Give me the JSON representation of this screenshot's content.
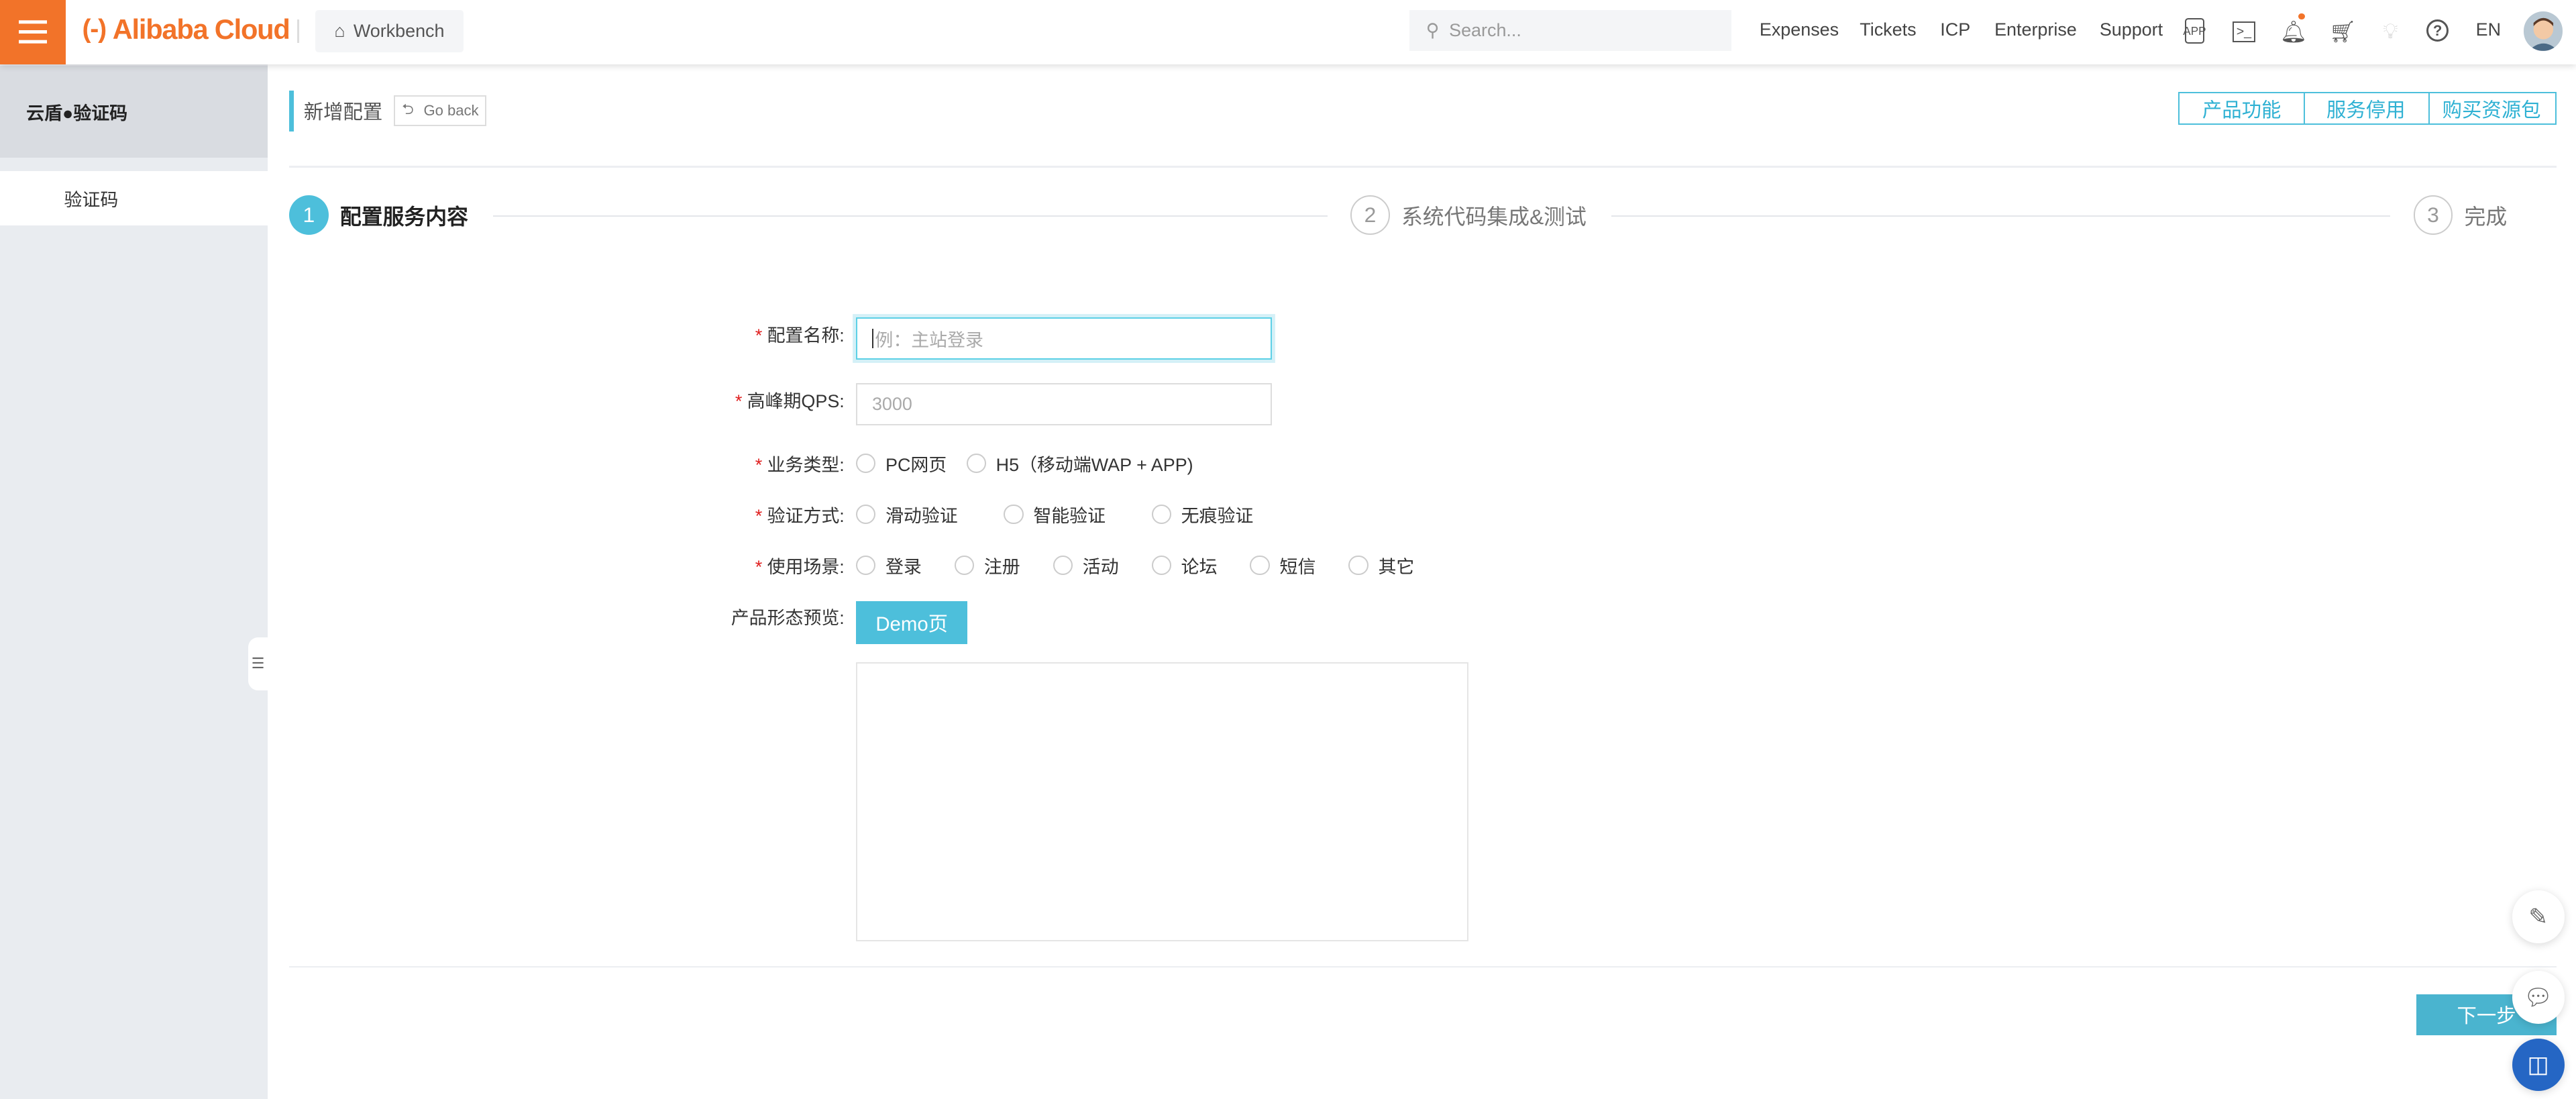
{
  "header": {
    "logo": "Alibaba Cloud",
    "workbench": "Workbench",
    "search_placeholder": "Search...",
    "nav": [
      "Expenses",
      "Tickets",
      "ICP",
      "Enterprise",
      "Support"
    ],
    "icons": [
      "app-icon",
      "terminal-icon",
      "bell-icon",
      "cart-icon",
      "lightbulb-icon",
      "help-icon"
    ],
    "lang": "EN",
    "accent": "#f27329"
  },
  "sidebar": {
    "title": "云盾●验证码",
    "items": [
      {
        "label": "验证码"
      }
    ]
  },
  "page": {
    "title": "新增配置",
    "go_back": "Go back",
    "top_buttons": [
      "产品功能",
      "服务停用",
      "购买资源包"
    ],
    "accent": "#4dbfdb"
  },
  "steps": [
    {
      "num": "1",
      "label": "配置服务内容",
      "active": true
    },
    {
      "num": "2",
      "label": "系统代码集成&测试",
      "active": false
    },
    {
      "num": "3",
      "label": "完成",
      "active": false
    }
  ],
  "form": {
    "name": {
      "label": "配置名称:",
      "placeholder": "例：主站登录",
      "value": ""
    },
    "qps": {
      "label": "高峰期QPS:",
      "placeholder": "3000",
      "value": ""
    },
    "biz": {
      "label": "业务类型:",
      "options": [
        "PC网页",
        "H5（移动端WAP + APP)"
      ]
    },
    "method": {
      "label": "验证方式:",
      "options": [
        "滑动验证",
        "智能验证",
        "无痕验证"
      ]
    },
    "scene": {
      "label": "使用场景:",
      "options": [
        "登录",
        "注册",
        "活动",
        "论坛",
        "短信",
        "其它"
      ]
    },
    "preview": {
      "label": "产品形态预览:",
      "button": "Demo页"
    }
  },
  "footer": {
    "next": "下一步"
  }
}
